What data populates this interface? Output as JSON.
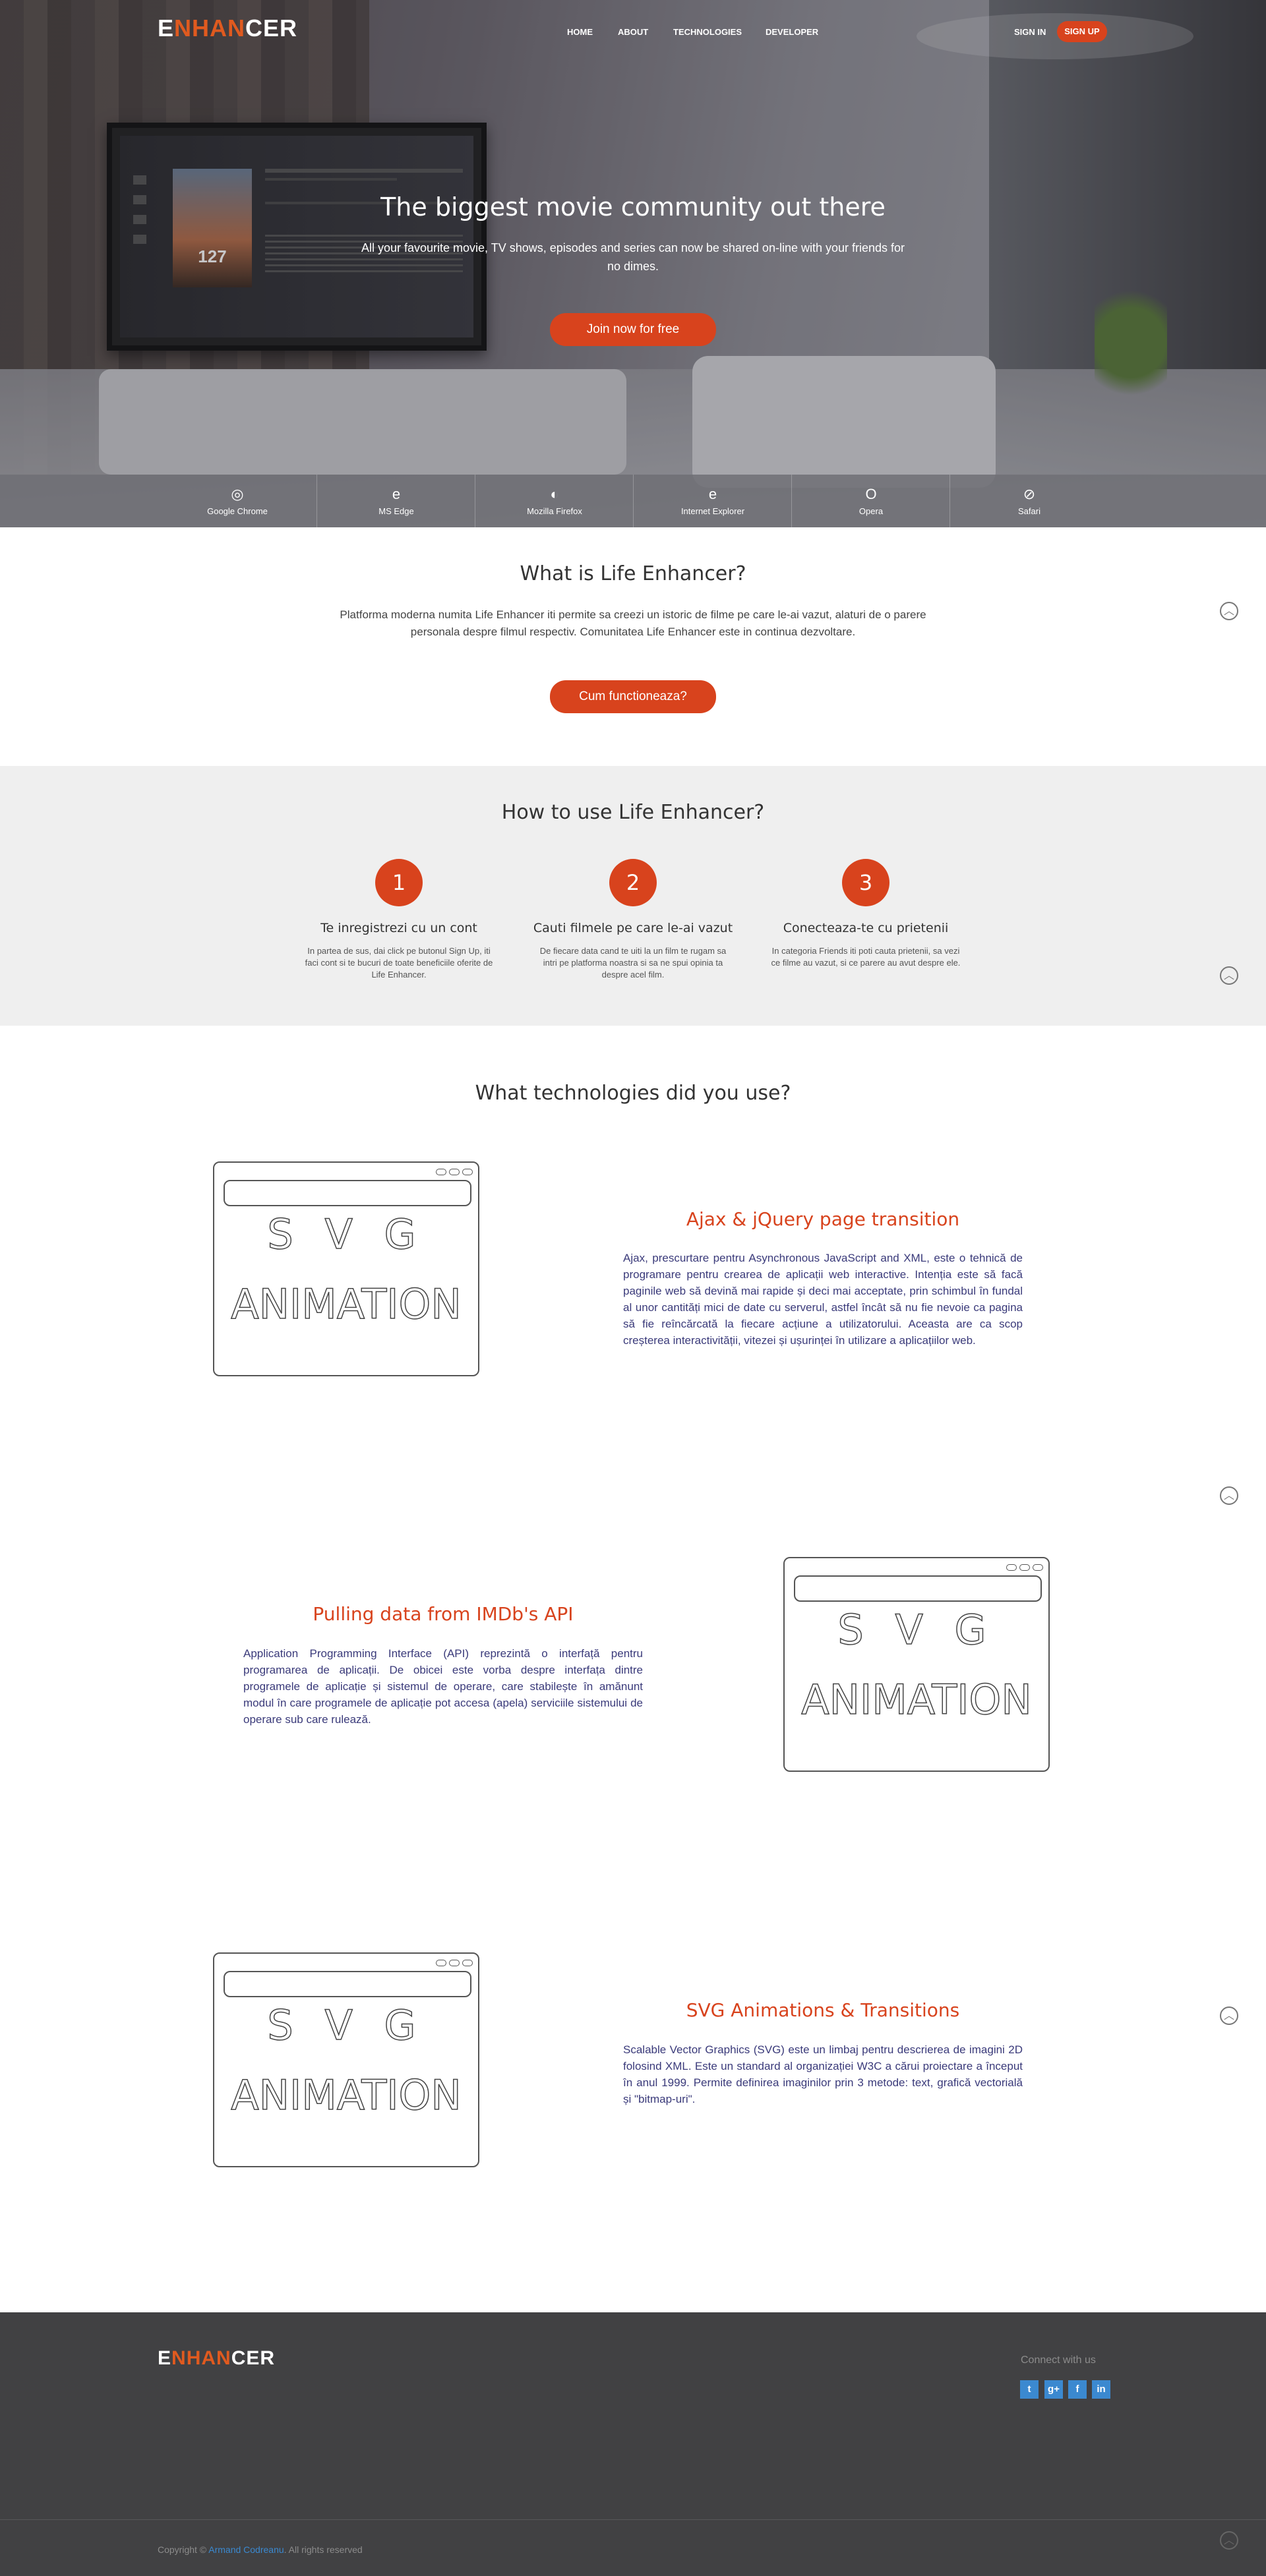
{
  "nav": {
    "logo_prefix": "E",
    "logo_mid": "N",
    "logo_o": "HAN",
    "logo_rest": "CER",
    "links": [
      "HOME",
      "ABOUT",
      "TECHNOLOGIES",
      "DEVELOPER"
    ],
    "sign_in": "SIGN IN",
    "sign_up": "SIGN UP"
  },
  "hero": {
    "title": "The biggest movie community out there",
    "subtitle": "All your favourite movie, TV shows, episodes and series can now be shared on-line with your friends for no dimes.",
    "cta": "Join now for free",
    "tv_rating": "127"
  },
  "browsers": [
    {
      "name": "Google Chrome",
      "icon": "chrome-icon",
      "glyph": "◎"
    },
    {
      "name": "MS Edge",
      "icon": "edge-icon",
      "glyph": "e"
    },
    {
      "name": "Mozilla Firefox",
      "icon": "firefox-icon",
      "glyph": "◐"
    },
    {
      "name": "Internet Explorer",
      "icon": "ie-icon",
      "glyph": "e"
    },
    {
      "name": "Opera",
      "icon": "opera-icon",
      "glyph": "O"
    },
    {
      "name": "Safari",
      "icon": "safari-icon",
      "glyph": "⊘"
    }
  ],
  "about": {
    "title": "What is Life Enhancer?",
    "text": "Platforma moderna numita Life Enhancer iti permite sa creezi un istoric de filme pe care le-ai vazut, alaturi de o parere personala despre filmul respectiv. Comunitatea Life Enhancer este in continua dezvoltare.",
    "cta": "Cum functioneaza?"
  },
  "how": {
    "title": "How to use Life Enhancer?",
    "steps": [
      {
        "num": "1",
        "title": "Te inregistrezi cu un cont",
        "text": "In partea de sus, dai click pe butonul Sign Up, iti faci cont si te bucuri de toate beneficiile oferite de Life Enhancer."
      },
      {
        "num": "2",
        "title": "Cauti filmele pe care le-ai vazut",
        "text": "De fiecare data cand te uiti la un film te rugam sa intri pe platforma noastra si sa ne spui opinia ta despre acel film."
      },
      {
        "num": "3",
        "title": "Conecteaza-te cu prietenii",
        "text": "In categoria Friends iti poti cauta prietenii, sa vezi ce filme au vazut, si ce parere au avut despre ele."
      }
    ]
  },
  "tech": {
    "title": "What technologies did you use?",
    "svg_line1": "S V G",
    "svg_line2": "ANIMATION",
    "items": [
      {
        "title": "Ajax & jQuery page transition",
        "text": "Ajax, prescurtare pentru Asynchronous JavaScript and XML, este o tehnică de programare pentru crearea de aplicații web interactive. Intenția este să facă paginile web să devină mai rapide și deci mai acceptate, prin schimbul în fundal al unor cantități mici de date cu serverul, astfel încât să nu fie nevoie ca pagina să fie reîncărcată la fiecare acțiune a utilizatorului. Aceasta are ca scop creșterea interactivității, vitezei și ușurinței în utilizare a aplicațiilor web."
      },
      {
        "title": "Pulling data from IMDb's API",
        "text": "Application Programming Interface (API) reprezintă o interfață pentru programarea de aplicații. De obicei este vorba despre interfața dintre programele de aplicație și sistemul de operare, care stabilește în amănunt modul în care programele de aplicație pot accesa (apela) serviciile sistemului de operare sub care rulează."
      },
      {
        "title": "SVG Animations & Transitions",
        "text": "Scalable Vector Graphics (SVG) este un limbaj pentru descrierea de imagini 2D folosind XML. Este un standard al organizației W3C a cărui proiectare a început în anul 1999. Permite definirea imaginilor prin 3 metode: text, grafică vectorială și \"bitmap-uri\"."
      }
    ]
  },
  "footer": {
    "connect": "Connect with us",
    "copyright_prefix": "Copyright ©",
    "author": "Armand Codreanu",
    "rights": ". All rights reserved",
    "social": [
      {
        "icon": "twitter-icon",
        "glyph": "t"
      },
      {
        "icon": "google-plus-icon",
        "glyph": "g+"
      },
      {
        "icon": "facebook-icon",
        "glyph": "f"
      },
      {
        "icon": "linkedin-icon",
        "glyph": "in"
      }
    ]
  },
  "colors": {
    "accent": "#d8431d",
    "footer_bg": "#414143",
    "how_bg": "#efefef",
    "link_blue": "#3b89d0"
  }
}
